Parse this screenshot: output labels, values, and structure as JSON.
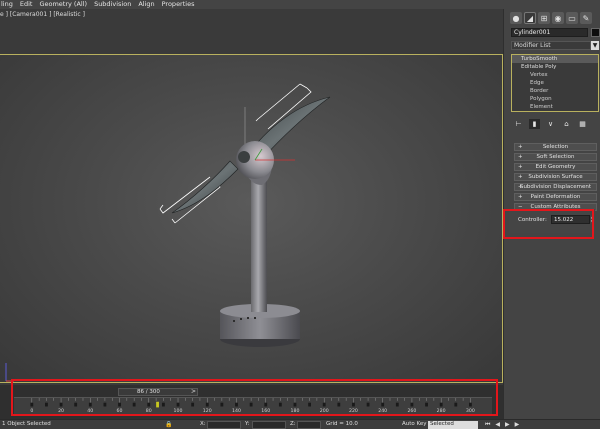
{
  "menu": [
    "ling",
    "Edit",
    "Geometry (All)",
    "Subdivision",
    "Align",
    "Properties"
  ],
  "viewport": {
    "label": "e ] [Camera001 ] [Realistic ]"
  },
  "panel": {
    "tabs": [
      "create-icon",
      "modify-icon",
      "hierarchy-icon",
      "motion-icon",
      "display-icon",
      "utilities-icon"
    ],
    "object_name": "Cylinder001",
    "object_color": "#0e0e0e",
    "modifier_list": "Modifier List",
    "stack": [
      {
        "label": "TurboSmooth",
        "level": 0
      },
      {
        "label": "Editable Poly",
        "level": 1
      },
      {
        "label": "Vertex",
        "level": 2
      },
      {
        "label": "Edge",
        "level": 2
      },
      {
        "label": "Border",
        "level": 2
      },
      {
        "label": "Polygon",
        "level": 2
      },
      {
        "label": "Element",
        "level": 2
      }
    ],
    "rollouts": [
      "Selection",
      "Soft Selection",
      "Edit Geometry",
      "Subdivision Surface",
      "Subdivision Displacement",
      "Paint Deformation",
      "Custom Attributes"
    ],
    "controller_label": "Controller:",
    "controller_value": "15.022"
  },
  "timeline": {
    "frame_display": "86 / 300",
    "current_frame": 86,
    "total_frames": 300,
    "prev": "<",
    "next": ">",
    "ticks": [
      "0",
      "20",
      "40",
      "60",
      "80",
      "100",
      "120",
      "140",
      "160",
      "180",
      "200",
      "220",
      "240",
      "260",
      "280",
      "300"
    ]
  },
  "status": {
    "selection": "1 Object Selected",
    "x_label": "X:",
    "y_label": "Y:",
    "z_label": "Z:",
    "grid": "Grid = 10.0",
    "auto_key": "Auto Key",
    "selected_option": "Selected"
  },
  "colors": {
    "highlight_border": "#e3161b",
    "selection_frame": "#b9b15e",
    "timeline_keys": "#1a1a1a",
    "current_frame_marker": "#c8c820"
  }
}
